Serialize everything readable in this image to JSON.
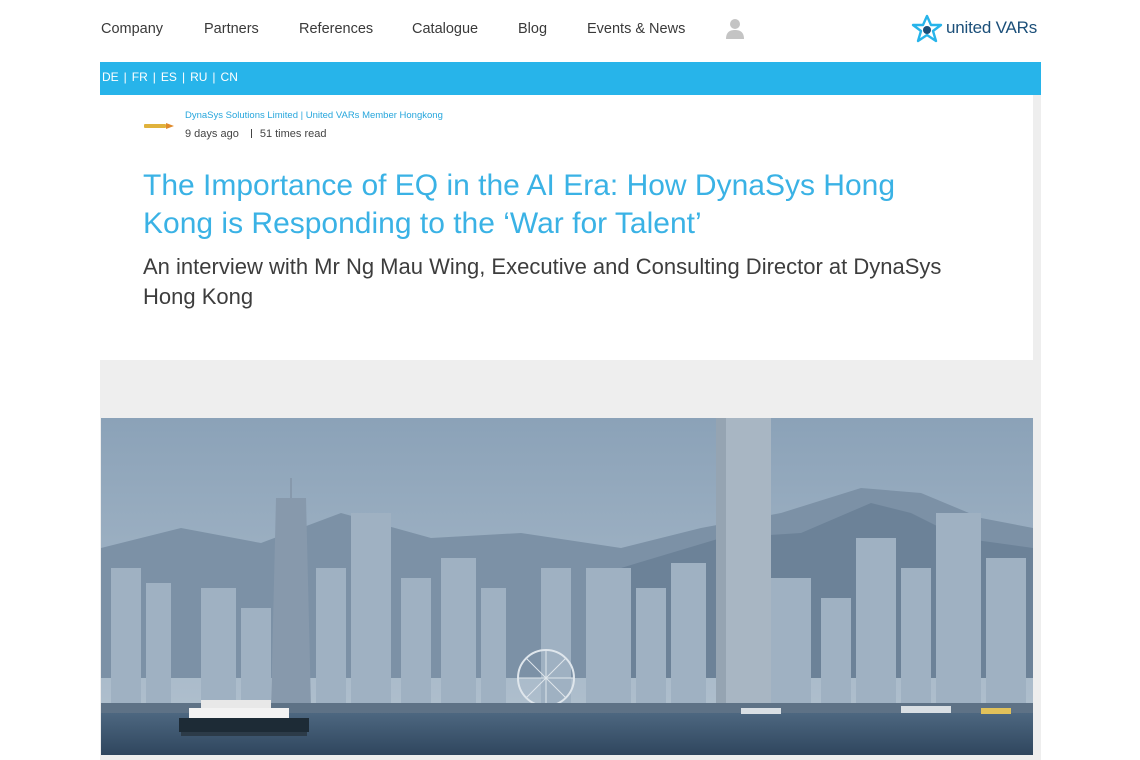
{
  "nav": {
    "items": [
      "Company",
      "Partners",
      "References",
      "Catalogue",
      "Blog",
      "Events & News"
    ],
    "user_icon": "user-icon"
  },
  "brand": {
    "name": "united VARs",
    "icon": "star-logo-icon",
    "color": "#1b4f79"
  },
  "languages": [
    "DE",
    "FR",
    "ES",
    "RU",
    "CN"
  ],
  "colors": {
    "accent": "#27b4ea",
    "title": "#3ab2e5"
  },
  "article": {
    "author": "DynaSys Solutions Limited | United VARs Member Hongkong",
    "posted": "9 days ago",
    "reads": "51 times read",
    "title": "The Importance of EQ in the AI Era: How DynaSys Hong Kong is Responding to the ‘War for Talent’",
    "subtitle": "An interview with Mr Ng Mau Wing, Executive and Consulting Director at DynaSys Hong Kong"
  }
}
